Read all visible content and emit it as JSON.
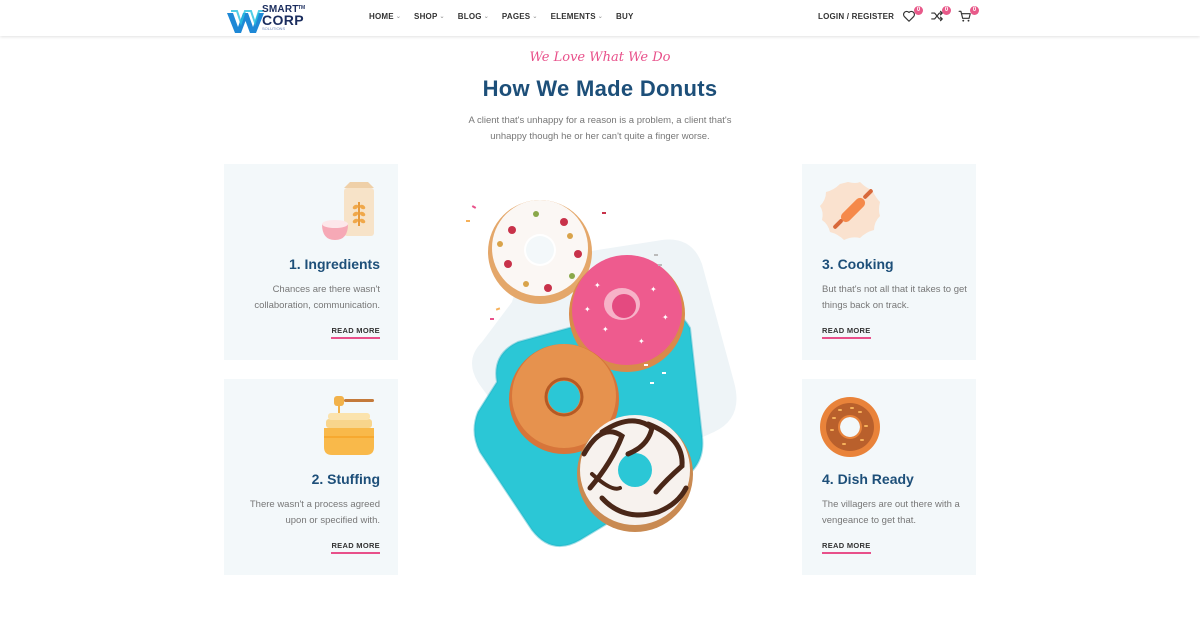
{
  "brand": {
    "line1": "SMART",
    "line2": "CORP",
    "line3": "SOLUTIONS",
    "tm": "TM",
    "accent": "#1d4f79",
    "pink": "#e8508a"
  },
  "nav": {
    "items": [
      {
        "label": "HOME",
        "has_caret": true
      },
      {
        "label": "SHOP",
        "has_caret": true
      },
      {
        "label": "BLOG",
        "has_caret": true
      },
      {
        "label": "PAGES",
        "has_caret": true
      },
      {
        "label": "ELEMENTS",
        "has_caret": true
      },
      {
        "label": "BUY",
        "has_caret": false
      }
    ],
    "caret": "⌄"
  },
  "header_actions": {
    "login_label": "LOGIN / REGISTER",
    "wishlist_count": "0",
    "compare_count": "0",
    "cart_count": "0"
  },
  "hero": {
    "eyebrow": "We Love What We Do",
    "title": "How We Made Donuts",
    "subtitle": "A client that's unhappy for a reason is a problem, a client that's unhappy though he or her can't quite a finger worse."
  },
  "steps": [
    {
      "title": "1. Ingredients",
      "text": "Chances are there wasn't collaboration, communication.",
      "link": "READ MORE",
      "icon": "flour-bag-icon"
    },
    {
      "title": "2. Stuffing",
      "text": "There wasn't a process agreed upon or specified with.",
      "link": "READ MORE",
      "icon": "honey-jar-icon"
    },
    {
      "title": "3. Cooking",
      "text": "But that's not all that it takes to get things back on track.",
      "link": "READ MORE",
      "icon": "rolling-pin-icon"
    },
    {
      "title": "4. Dish Ready",
      "text": "The villagers are out there with a vengeance to get that.",
      "link": "READ MORE",
      "icon": "donut-icon"
    }
  ]
}
